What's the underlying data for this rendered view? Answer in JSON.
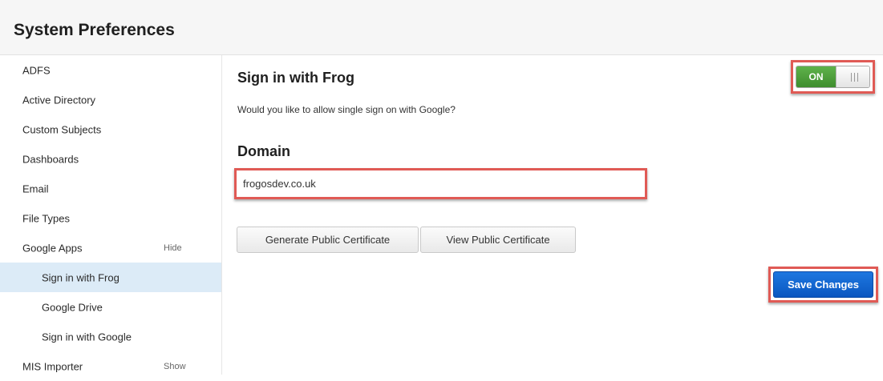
{
  "header": {
    "title": "System Preferences"
  },
  "sidebar": {
    "items": [
      {
        "label": "ADFS"
      },
      {
        "label": "Active Directory"
      },
      {
        "label": "Custom Subjects"
      },
      {
        "label": "Dashboards"
      },
      {
        "label": "Email"
      },
      {
        "label": "File Types"
      },
      {
        "label": "Google Apps",
        "toggle": "Hide"
      },
      {
        "label": "Sign in with Frog",
        "active": true
      },
      {
        "label": "Google Drive"
      },
      {
        "label": "Sign in with Google"
      },
      {
        "label": "MIS Importer",
        "toggle": "Show"
      }
    ]
  },
  "main": {
    "section_title": "Sign in with Frog",
    "description": "Would you like to allow single sign on with Google?",
    "toggle": {
      "label": "ON",
      "state": "on"
    },
    "domain": {
      "title": "Domain",
      "value": "frogosdev.co.uk"
    },
    "buttons": {
      "generate_label": "Generate Public Certificate",
      "view_label": "View Public Certificate",
      "save_label": "Save Changes"
    }
  }
}
